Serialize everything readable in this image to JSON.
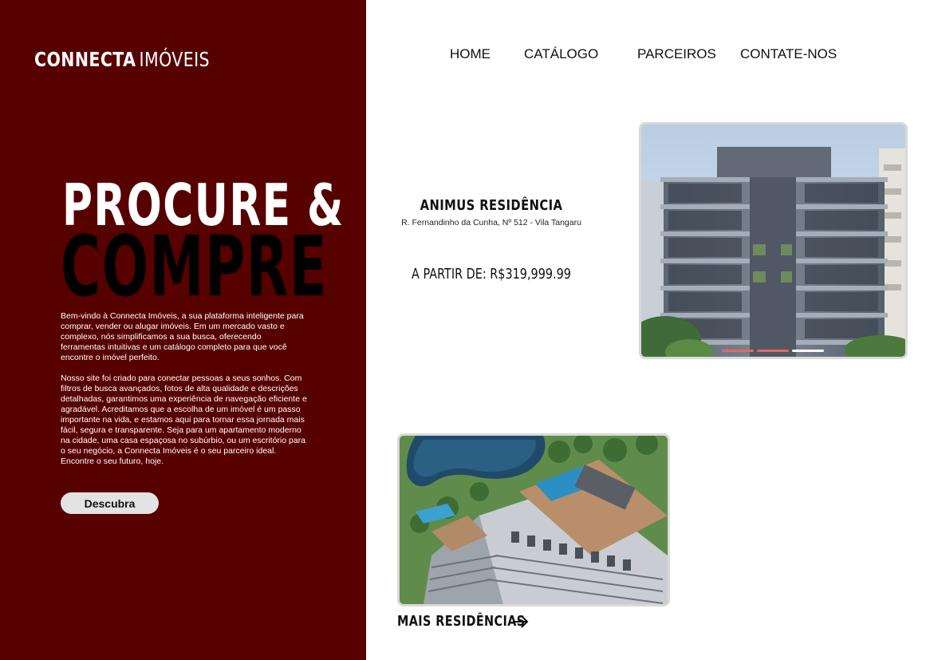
{
  "brand": {
    "name_bold": "CONNECTA",
    "name_light": "IMÓVEIS"
  },
  "nav": {
    "items": [
      {
        "label": "HOME"
      },
      {
        "label": "CATÁLOGO"
      },
      {
        "label": "PARCEIROS"
      },
      {
        "label": "CONTATE-NOS"
      }
    ]
  },
  "hero": {
    "line1": "PROCURE &",
    "line2": "COMPRE",
    "paragraphs": [
      "Bem-vindo à Connecta Imóveis, a sua plataforma inteligente para comprar, vender ou alugar imóveis. Em um mercado vasto e complexo, nós simplificamos a sua busca, oferecendo ferramentas intuitivas e um catálogo completo para que você encontre o imóvel perfeito.",
      "Nosso site foi criado para conectar pessoas a seus sonhos. Com filtros de busca avançados, fotos de alta qualidade e descrições detalhadas, garantimos uma experiência de navegação eficiente e agradável. Acreditamos que a escolha de um imóvel é um passo importante na vida, e estamos aqui para tornar essa jornada mais fácil, segura e transparente. Seja para um apartamento moderno na cidade, uma casa espaçosa no subúrbio, ou um escritório para o seu negócio, a Connecta Imóveis é o seu parceiro ideal. Encontre o seu futuro, hoje."
    ],
    "cta_label": "Descubra"
  },
  "featured": {
    "title": "ANIMUS RESIDÊNCIA",
    "address": "R. Fernandinho da Cunha, Nº 512 - Vila Tangaru",
    "price": "A PARTIR DE: R$319,999.99",
    "carousel": {
      "slides": 3,
      "active_index": 2
    }
  },
  "more": {
    "label": "MAIS RESIDÊNCIAS",
    "icon": "arrow-right-icon"
  },
  "colors": {
    "panel": "#570000",
    "hero_line2": "#000000",
    "button_bg": "#e3e3e3",
    "dot_inactive": "#e06a6a",
    "dot_active": "#ffffff"
  }
}
